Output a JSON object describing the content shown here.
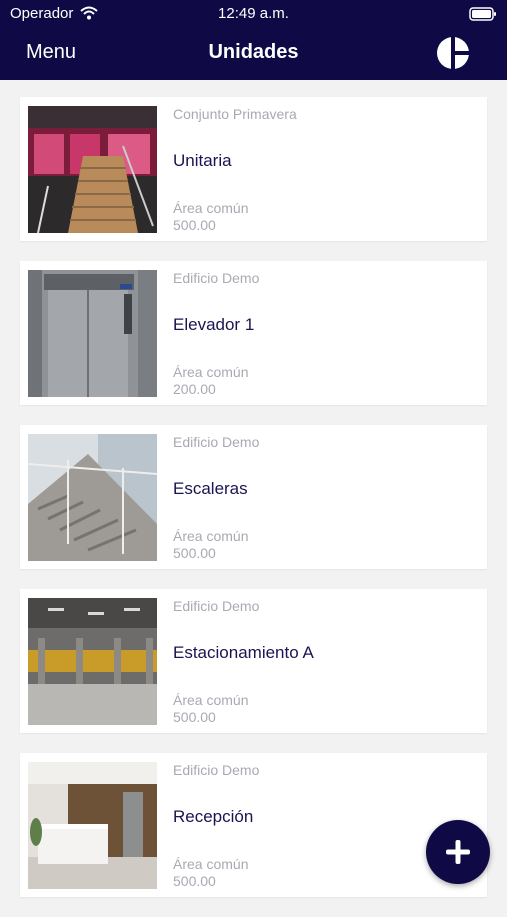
{
  "status_bar": {
    "carrier": "Operador",
    "time": "12:49 a.m."
  },
  "header": {
    "menu_label": "Menu",
    "title": "Unidades",
    "logo_icon": "brand-logo-icon"
  },
  "colors": {
    "header_bg": "#0f0a45",
    "accent": "#0f0a45",
    "name_text": "#1a1452",
    "muted_text": "#a9a9b3",
    "background": "#f2f2f2"
  },
  "units": [
    {
      "building": "Conjunto Primavera",
      "name": "Unitaria",
      "type": "Área común",
      "area": "500.00",
      "image": "staircase-red-windows-photo"
    },
    {
      "building": "Edificio Demo",
      "name": "Elevador 1",
      "type": "Área común",
      "area": "200.00",
      "image": "elevator-photo"
    },
    {
      "building": "Edificio Demo",
      "name": "Escaleras",
      "type": "Área común",
      "area": "500.00",
      "image": "stairs-railing-photo"
    },
    {
      "building": "Edificio Demo",
      "name": "Estacionamiento A",
      "type": "Área común",
      "area": "500.00",
      "image": "parking-garage-photo"
    },
    {
      "building": "Edificio Demo",
      "name": "Recepción",
      "type": "Área común",
      "area": "500.00",
      "image": "reception-desk-photo"
    }
  ],
  "fab": {
    "icon": "plus-icon"
  }
}
